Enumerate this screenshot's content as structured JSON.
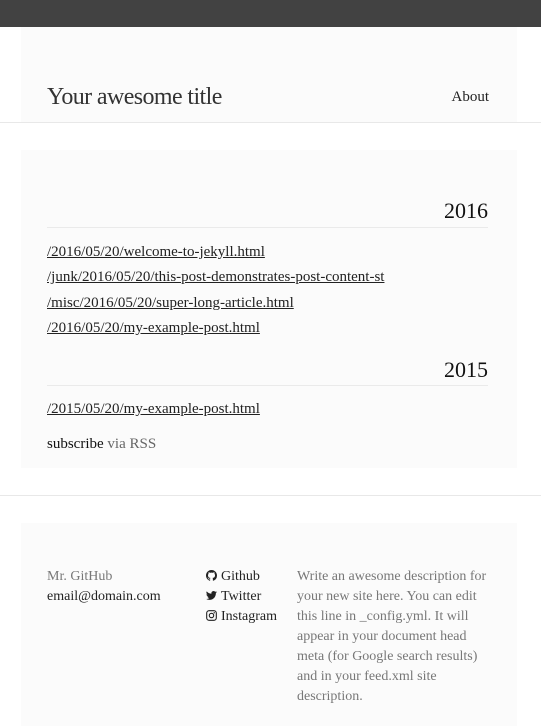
{
  "header": {
    "site_title": "Your awesome title",
    "nav": {
      "about": "About"
    }
  },
  "posts": {
    "years": [
      {
        "year": "2016",
        "links": [
          "/2016/05/20/welcome-to-jekyll.html",
          "/junk/2016/05/20/this-post-demonstrates-post-content-st",
          "/misc/2016/05/20/super-long-article.html",
          "/2016/05/20/my-example-post.html"
        ]
      },
      {
        "year": "2015",
        "links": [
          "/2015/05/20/my-example-post.html"
        ]
      }
    ],
    "subscribe": {
      "prefix": "subscribe",
      "link": "via RSS"
    }
  },
  "footer": {
    "name": "Mr. GitHub",
    "email": "email@domain.com",
    "social": [
      {
        "label": "Github",
        "icon": "github-icon"
      },
      {
        "label": "Twitter",
        "icon": "twitter-icon"
      },
      {
        "label": "Instagram",
        "icon": "instagram-icon"
      }
    ],
    "description": "Write an awesome description for your new site here. You can edit this line in _config.yml. It will appear in your document head meta (for Google search results) and in your feed.xml site description."
  },
  "colors": {
    "topbar": "#424242",
    "panel": "#fbfbfb",
    "text": "#222222",
    "muted": "#777777"
  }
}
